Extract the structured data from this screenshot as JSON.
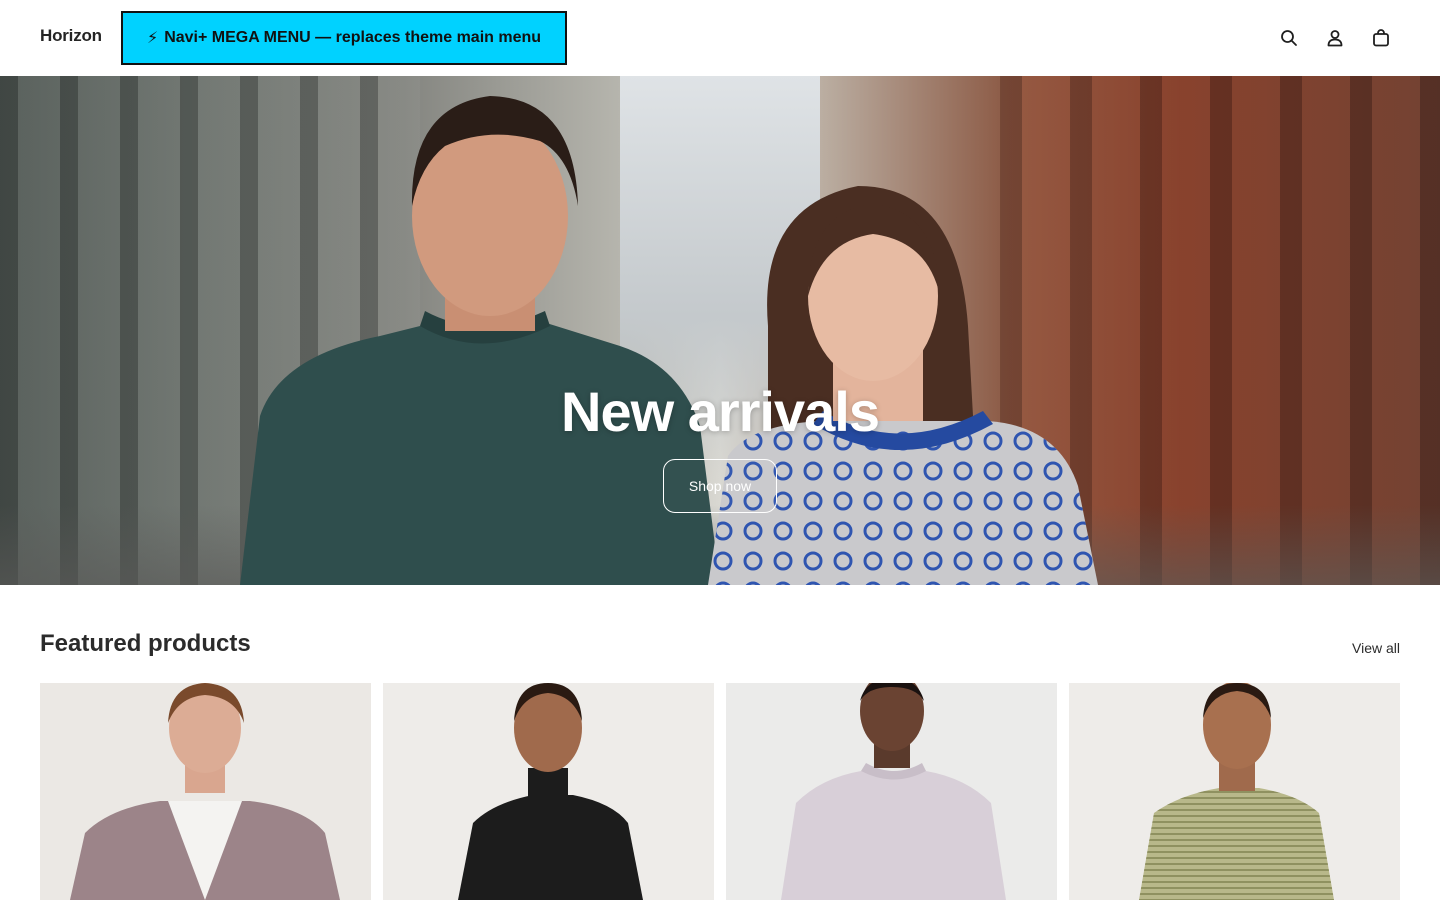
{
  "header": {
    "logo": "Horizon",
    "mega_menu_label": "Navi+ MEGA MENU — replaces theme main menu",
    "mega_menu_bolt": "⚡",
    "mega_menu_color": "#00d2ff",
    "icons": [
      "search-icon",
      "account-icon",
      "cart-icon"
    ]
  },
  "hero": {
    "title": "New arrivals",
    "button_label": "Shop now"
  },
  "featured": {
    "title": "Featured products",
    "view_all": "View all",
    "products": [
      {
        "image": "man-pink-cardigan"
      },
      {
        "image": "woman-black-top"
      },
      {
        "image": "man-lilac-sweater"
      },
      {
        "image": "woman-green-striped-top"
      }
    ]
  }
}
